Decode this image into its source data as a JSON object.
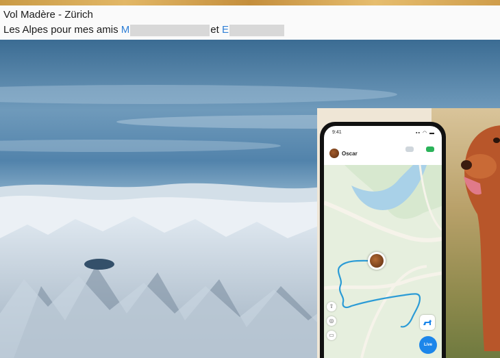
{
  "post": {
    "title": "Vol Madère - Zürich",
    "caption_prefix": "Les Alpes pour mes amis ",
    "mention_1_initial": "M",
    "connector": "et ",
    "mention_2_initial": "E"
  },
  "ad": {
    "status_time": "9:41",
    "status_icons": "▪▪ ◠ ▬",
    "pet_name": "Oscar",
    "live_label": "Live"
  },
  "colors": {
    "mention": "#2f7fd6",
    "live_button": "#1c86ea",
    "route": "#2b9bd6"
  },
  "icons": [
    "share-icon",
    "locate-icon",
    "layers-icon",
    "dog-walk-icon"
  ]
}
